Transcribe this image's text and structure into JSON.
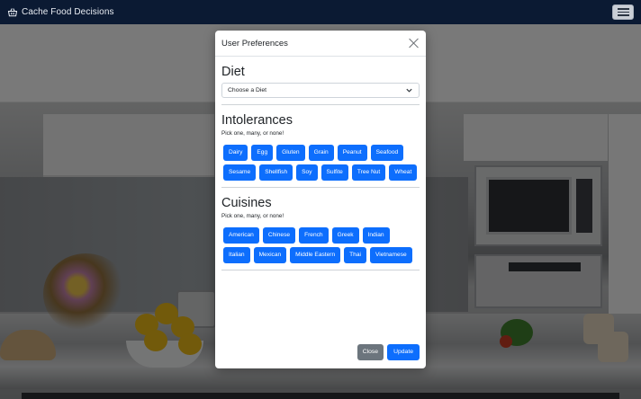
{
  "navbar": {
    "brand_icon": "shopping-basket-icon",
    "brand_text": "Cache Food Decisions",
    "menu_icon": "hamburger-menu-icon"
  },
  "modal": {
    "title": "User Preferences",
    "close_icon": "close-icon",
    "diet": {
      "heading": "Diet",
      "select_value": "Choose a Diet",
      "chevron_icon": "chevron-down-icon"
    },
    "intolerances": {
      "heading": "Intolerances",
      "hint": "Pick one, many, or none!",
      "options": [
        "Dairy",
        "Egg",
        "Gluten",
        "Grain",
        "Peanut",
        "Seafood",
        "Sesame",
        "Shellfish",
        "Soy",
        "Sulfite",
        "Tree Nut",
        "Wheat"
      ]
    },
    "cuisines": {
      "heading": "Cuisines",
      "hint": "Pick one, many, or none!",
      "options": [
        "American",
        "Chinese",
        "French",
        "Greek",
        "Indian",
        "Italian",
        "Mexican",
        "Middle Eastern",
        "Thai",
        "Vietnamese"
      ]
    },
    "footer": {
      "close_label": "Close",
      "update_label": "Update"
    }
  },
  "colors": {
    "navbar_bg": "#0b1a33",
    "primary": "#0d6efd",
    "secondary": "#6c757d"
  }
}
